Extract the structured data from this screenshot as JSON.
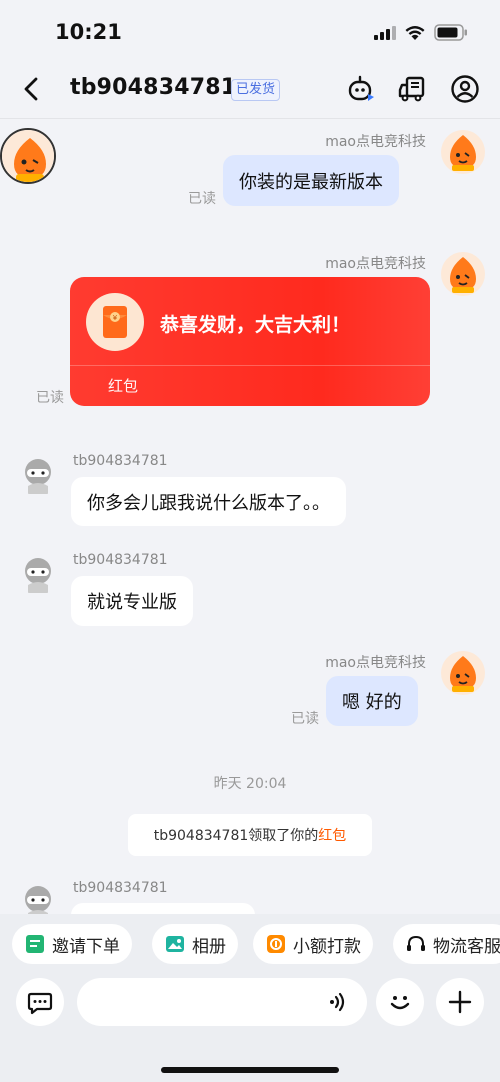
{
  "status_bar": {
    "time": "10:21"
  },
  "header": {
    "title": "tb904834781",
    "badge": "已发货",
    "icons": [
      "robot-icon",
      "truck-icon",
      "user-icon"
    ]
  },
  "messages": {
    "m1": {
      "sender": "mao点电竞科技",
      "text": "你装的是最新版本",
      "status": "已读"
    },
    "m2": {
      "sender": "mao点电竞科技",
      "text": "恭喜发财，大吉大利！",
      "label": "红包",
      "status": "已读"
    },
    "m3": {
      "sender": "tb904834781",
      "text": "你多会儿跟我说什么版本了。。"
    },
    "m4": {
      "sender": "tb904834781",
      "text": "就说专业版"
    },
    "m5": {
      "sender": "mao点电竞科技",
      "text": "嗯 好的",
      "status": "已读"
    },
    "timestamp": "昨天 20:04",
    "notice": {
      "prefix": "tb904834781领取了你的",
      "highlight": "红包"
    },
    "m6": {
      "sender": "tb904834781"
    }
  },
  "quick_actions": [
    "邀请下单",
    "相册",
    "小额打款",
    "物流客服"
  ],
  "input": {
    "placeholder": ""
  },
  "colors": {
    "accent_red": "#ff3b30",
    "my_bubble": "#dde7ff",
    "badge_blue": "#4a6fe0",
    "highlight_orange": "#ff5a00"
  }
}
